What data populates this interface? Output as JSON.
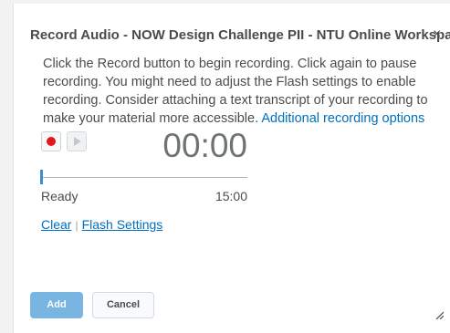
{
  "dialog": {
    "title": "Record Audio - NOW Design Challenge PII - NTU Online Workspace",
    "close_label": "×"
  },
  "instructions": {
    "text": "Click the Record button to begin recording. Click again to pause recording. You might need to adjust the Flash settings to enable recording. Consider attaching a text transcript of your recording to make your material more accessible. ",
    "link_label": "Additional recording options"
  },
  "recorder": {
    "timer": "00:00",
    "status": "Ready",
    "max_duration": "15:00",
    "progress": 0,
    "record_icon": "record-icon",
    "play_icon": "play-icon",
    "record_color": "#e2151b"
  },
  "links": {
    "clear_label": "Clear",
    "separator": "|",
    "flash_settings_label": "Flash Settings"
  },
  "buttons": {
    "add_label": "Add",
    "cancel_label": "Cancel",
    "primary_color": "#79b5e3"
  }
}
